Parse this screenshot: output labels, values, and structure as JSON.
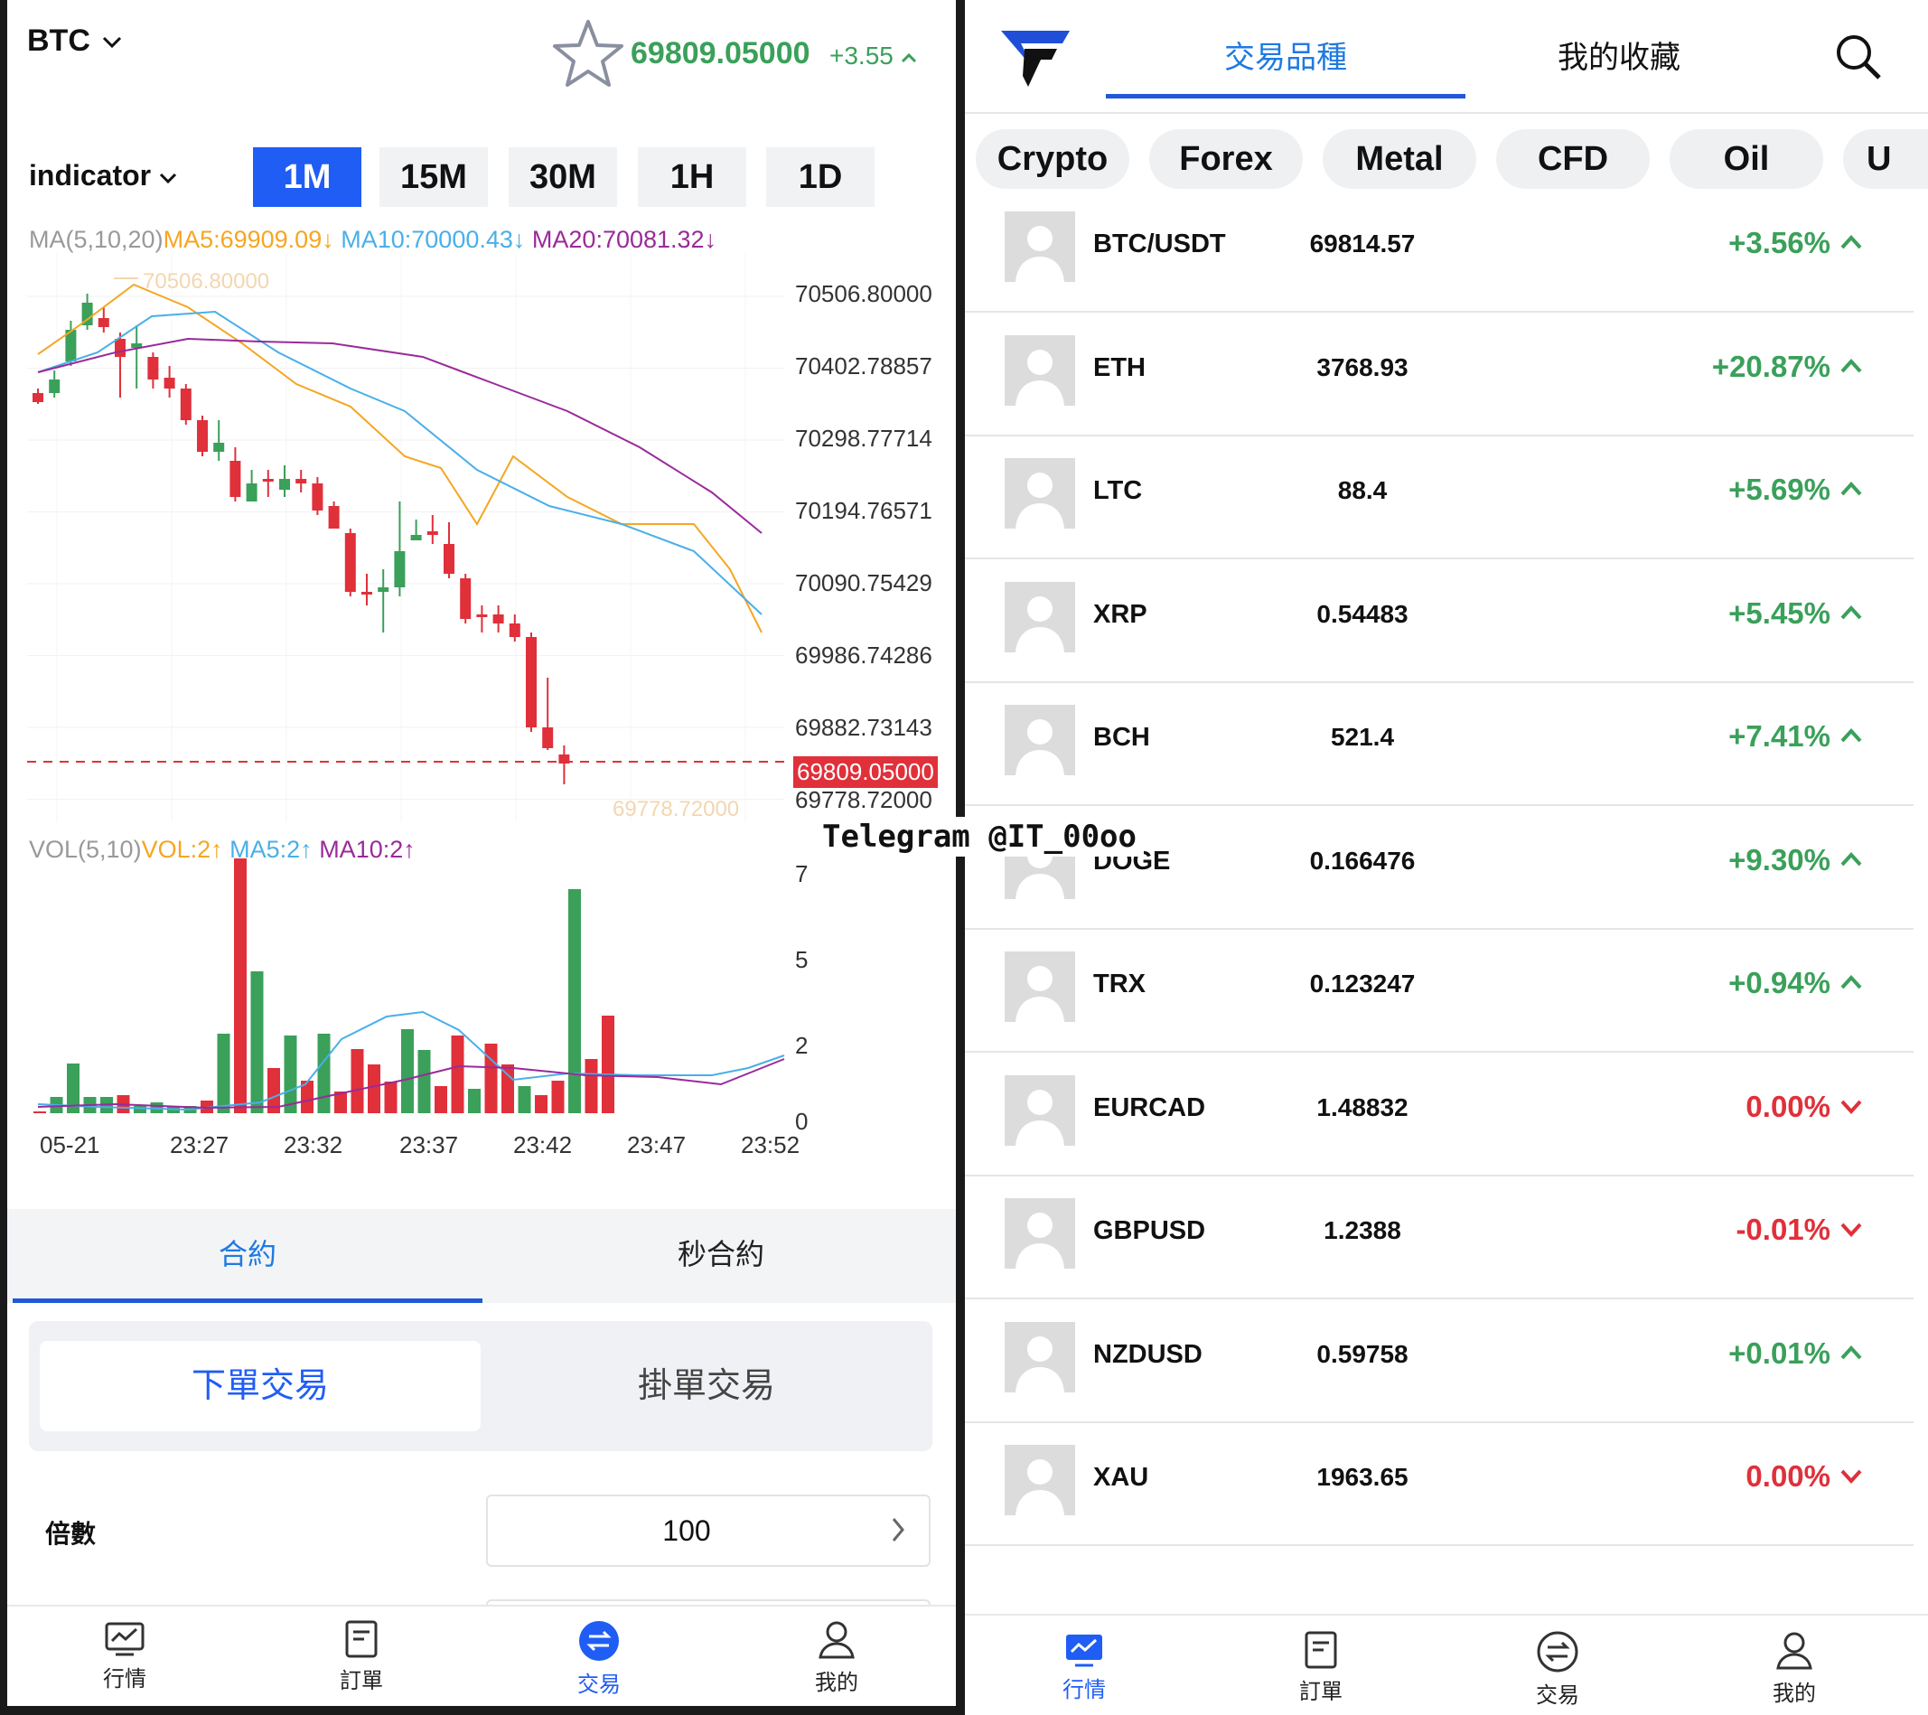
{
  "left": {
    "symbol": "BTC",
    "price": "69809.05000",
    "change": "+3.55",
    "indicator_label": "indicator",
    "timeframes": [
      "1M",
      "15M",
      "30M",
      "1H",
      "1D"
    ],
    "active_timeframe": "1M",
    "ma_legend": {
      "prefix": "MA(5,10,20)",
      "ma5": "MA5:69909.09",
      "ma10": "MA10:70000.43",
      "ma20": "MA20:70081.32"
    },
    "high_marker": "70506.80000",
    "low_marker": "69778.72000",
    "price_axis": [
      "70506.80000",
      "70402.78857",
      "70298.77714",
      "70194.76571",
      "70090.75429",
      "69986.74286",
      "69882.73143",
      "69778.72000"
    ],
    "current_price_tag": "69809.05000",
    "vol_legend": {
      "prefix": "VOL(5,10)",
      "vol": "VOL:2",
      "ma5": "MA5:2",
      "ma10": "MA10:2"
    },
    "vol_axis": [
      "7",
      "5",
      "2",
      "0"
    ],
    "time_axis": [
      "05-21",
      "23:27",
      "23:32",
      "23:37",
      "23:42",
      "23:47",
      "23:52"
    ],
    "watermark": "Telegram @IT_00oo",
    "contract_tabs": [
      "合約",
      "秒合約"
    ],
    "order_tabs": [
      "下單交易",
      "掛單交易"
    ],
    "leverage_label": "倍數",
    "leverage_value": "100",
    "nav": [
      "行情",
      "訂單",
      "交易",
      "我的"
    ],
    "active_nav": "交易"
  },
  "right": {
    "tabs": [
      "交易品種",
      "我的收藏"
    ],
    "categories": [
      "Crypto",
      "Forex",
      "Metal",
      "CFD",
      "Oil",
      "U"
    ],
    "markets": [
      {
        "symbol": "BTC/USDT",
        "price": "69814.57",
        "change": "+3.56%",
        "dir": "up"
      },
      {
        "symbol": "ETH",
        "price": "3768.93",
        "change": "+20.87%",
        "dir": "up"
      },
      {
        "symbol": "LTC",
        "price": "88.4",
        "change": "+5.69%",
        "dir": "up"
      },
      {
        "symbol": "XRP",
        "price": "0.54483",
        "change": "+5.45%",
        "dir": "up"
      },
      {
        "symbol": "BCH",
        "price": "521.4",
        "change": "+7.41%",
        "dir": "up"
      },
      {
        "symbol": "DOGE",
        "price": "0.166476",
        "change": "+9.30%",
        "dir": "up"
      },
      {
        "symbol": "TRX",
        "price": "0.123247",
        "change": "+0.94%",
        "dir": "up"
      },
      {
        "symbol": "EURCAD",
        "price": "1.48832",
        "change": "0.00%",
        "dir": "down"
      },
      {
        "symbol": "GBPUSD",
        "price": "1.2388",
        "change": "-0.01%",
        "dir": "down"
      },
      {
        "symbol": "NZDUSD",
        "price": "0.59758",
        "change": "+0.01%",
        "dir": "up"
      },
      {
        "symbol": "XAU",
        "price": "1963.65",
        "change": "0.00%",
        "dir": "down"
      }
    ],
    "nav": [
      "行情",
      "訂單",
      "交易",
      "我的"
    ],
    "active_nav": "行情"
  },
  "colors": {
    "accent": "#1f5df5",
    "up": "#3aa05a",
    "down": "#e0303a",
    "ma5": "#f5a623",
    "ma10": "#4aafe8",
    "ma20": "#9a2a9a"
  },
  "chart_data": [
    {
      "type": "candlestick",
      "title": "",
      "ylim": [
        69778.72,
        70506.8
      ],
      "x": [
        "05-21",
        "23:27",
        "23:32",
        "23:37",
        "23:42",
        "23:47",
        "23:52"
      ],
      "series": [
        {
          "name": "MA5",
          "values": [
            69909.09
          ]
        },
        {
          "name": "MA10",
          "values": [
            70000.43
          ]
        },
        {
          "name": "MA20",
          "values": [
            70081.32
          ]
        }
      ]
    },
    {
      "type": "bar",
      "title": "",
      "ylim": [
        0,
        7
      ],
      "x": [
        "05-21",
        "23:27",
        "23:32",
        "23:37",
        "23:42",
        "23:47",
        "23:52"
      ],
      "series": [
        {
          "name": "VOL",
          "values": [
            2
          ]
        },
        {
          "name": "MA5",
          "values": [
            2
          ]
        },
        {
          "name": "MA10",
          "values": [
            2
          ]
        }
      ]
    }
  ]
}
